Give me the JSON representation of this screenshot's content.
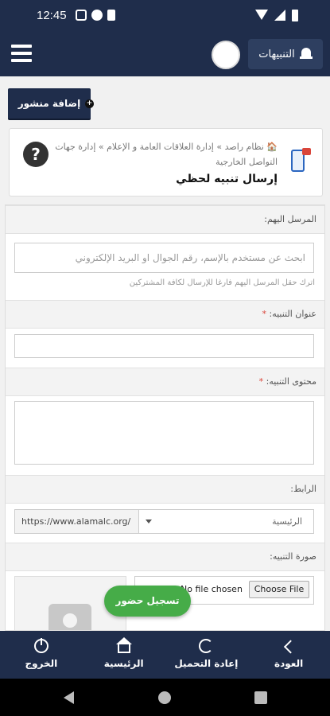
{
  "status": {
    "time": "12:45"
  },
  "appbar": {
    "notifications_label": "التنبيهات"
  },
  "add_post": {
    "label": "إضافة منشور"
  },
  "breadcrumb": {
    "text": "🏠 نظام راصد » إدارة العلاقات العامة و الإعلام » إدارة جهات التواصل الخارجية",
    "page_title": "إرسال تنبيه لحظي"
  },
  "form": {
    "recipients": {
      "label": "المرسل اليهم:",
      "placeholder": "ابحث عن مستخدم بالإسم، رقم الجوال او البريد الإلكتروني",
      "hint": "اترك حقل المرسل اليهم فارغا للإرسال لكافة المشتركين"
    },
    "title_field": {
      "label": "عنوان التنبيه:",
      "required_mark": "*",
      "value": ""
    },
    "content_field": {
      "label": "محتوى التنبيه:",
      "required_mark": "*",
      "value": ""
    },
    "link": {
      "label": "الرابط:",
      "url_prefix": "https://www.alamalc.org/",
      "selected_page": "الرئيسية"
    },
    "image": {
      "label": "صورة التنبيه:",
      "choose_file": "Choose File",
      "no_file": "No file chosen"
    }
  },
  "attend_button": {
    "label": "تسجيل حضور"
  },
  "bottom_nav": {
    "logout": "الخروج",
    "home": "الرئيسية",
    "reload": "إعادة التحميل",
    "back": "العودة"
  }
}
